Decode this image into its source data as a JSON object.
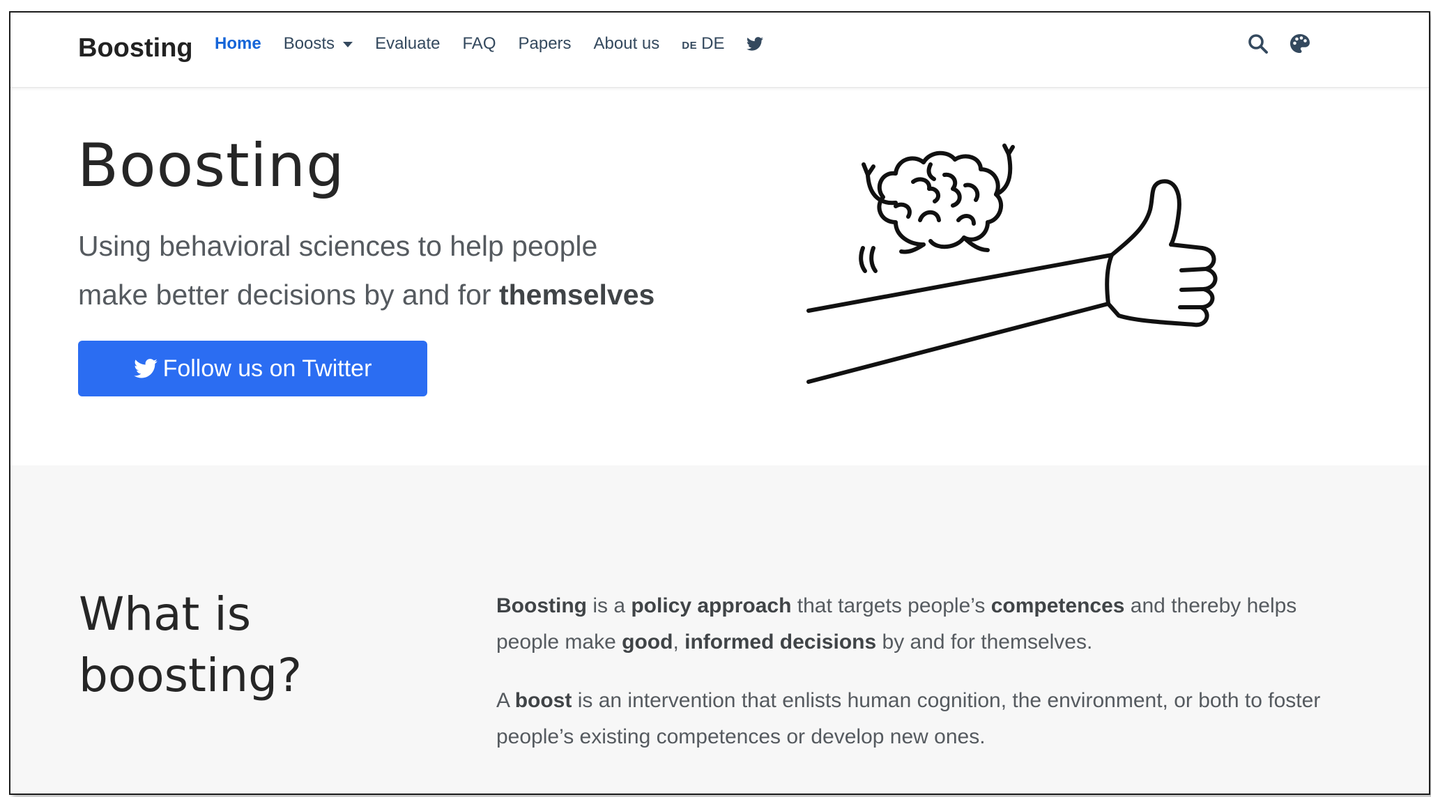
{
  "brand": "Boosting",
  "nav": {
    "items": [
      {
        "label": "Home",
        "active": true
      },
      {
        "label": "Boosts",
        "dropdown": true
      },
      {
        "label": "Evaluate"
      },
      {
        "label": "FAQ"
      },
      {
        "label": "Papers"
      },
      {
        "label": "About us"
      }
    ],
    "language": {
      "code": "DE",
      "label": "DE"
    },
    "social_icon": "twitter-icon",
    "right_icons": [
      "search-icon",
      "palette-icon"
    ]
  },
  "hero": {
    "title": "Boosting",
    "subtitle_line1": "Using behavioral sciences to help people",
    "subtitle_line2_prefix": "make better decisions by and for ",
    "subtitle_line2_bold": "themselves",
    "button_label": "Follow us on Twitter",
    "button_icon": "twitter-icon",
    "illustration": "brain-riding-thumbs-up-arm"
  },
  "what_is": {
    "title_line1": "What is",
    "title_line2": "boosting?",
    "p1": {
      "b1": "Boosting",
      "t1": " is a ",
      "b2": "policy approach",
      "t2": " that targets people’s ",
      "b3": "competences",
      "t3": " and thereby helps people make ",
      "b4": "good",
      "t4": ", ",
      "b5": "informed decisions",
      "t5": " by and for themselves."
    },
    "p2": {
      "t1": "A ",
      "b1": "boost",
      "t2": " is an intervention that enlists human cognition, the environment, or both to foster people’s existing competences or develop new ones."
    }
  },
  "colors": {
    "accent": "#2b6df2",
    "active_nav": "#1565d8",
    "nav_text": "#34495e",
    "section_bg": "#f7f7f7"
  }
}
